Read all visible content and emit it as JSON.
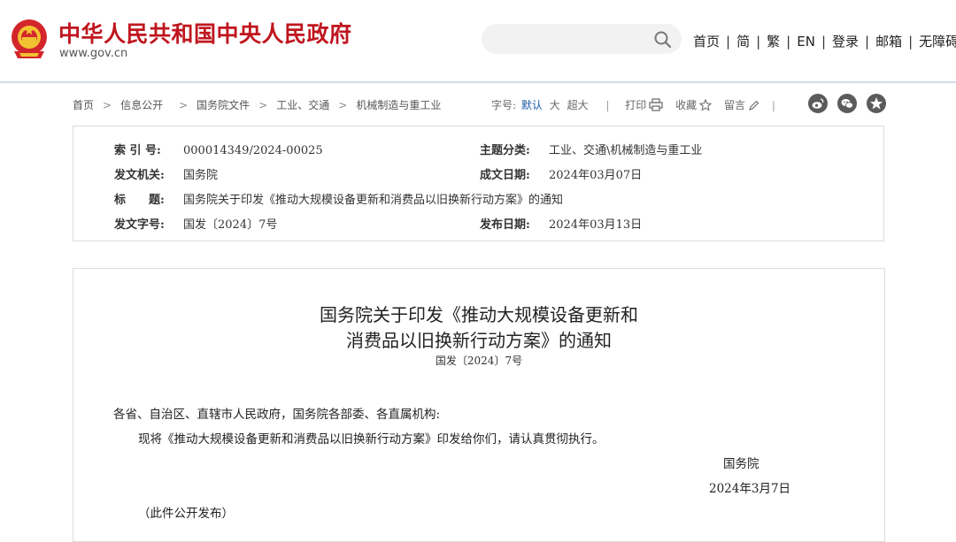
{
  "header": {
    "site_title": "中华人民共和国中央人民政府",
    "site_url": "www.gov.cn",
    "search": {
      "placeholder": "",
      "value": ""
    },
    "nav": [
      "首页",
      "简",
      "繁",
      "EN",
      "登录",
      "邮箱",
      "无障碍"
    ]
  },
  "breadcrumb": [
    "首页",
    "信息公开",
    "国务院文件",
    "工业、交通",
    "机械制造与重工业"
  ],
  "toolbar": {
    "font_size_label": "字号:",
    "font_sizes": [
      "默认",
      "大",
      "超大"
    ],
    "font_size_selected": "默认",
    "print_label": "打印",
    "favorite_label": "收藏",
    "comment_label": "留言",
    "share_icons": [
      "weibo-icon",
      "wechat-icon",
      "qzone-icon"
    ]
  },
  "meta": {
    "index_label": "索 引 号:",
    "index_value": "000014349/2024-00025",
    "category_label": "主题分类:",
    "category_value": "工业、交通\\机械制造与重工业",
    "issuer_label": "发文机关:",
    "issuer_value": "国务院",
    "written_date_label": "成文日期:",
    "written_date_value": "2024年03月07日",
    "title_label": "标　　题:",
    "title_value": "国务院关于印发《推动大规模设备更新和消费品以旧换新行动方案》的通知",
    "doc_no_label": "发文字号:",
    "doc_no_value": "国发〔2024〕7号",
    "publish_date_label": "发布日期:",
    "publish_date_value": "2024年03月13日"
  },
  "article": {
    "title_line1": "国务院关于印发《推动大规模设备更新和",
    "title_line2": "消费品以旧换新行动方案》的通知",
    "doc_number": "国发〔2024〕7号",
    "salutation": "各省、自治区、直辖市人民政府，国务院各部委、各直属机构:",
    "body": "现将《推动大规模设备更新和消费品以旧换新行动方案》印发给你们，请认真贯彻执行。",
    "signature": "国务院",
    "date": "2024年3月7日",
    "note": "（此件公开发布）"
  },
  "colors": {
    "brand_red": "#c0161e",
    "link_blue": "#1b5aa6",
    "header_rule": "#cfdcea"
  }
}
